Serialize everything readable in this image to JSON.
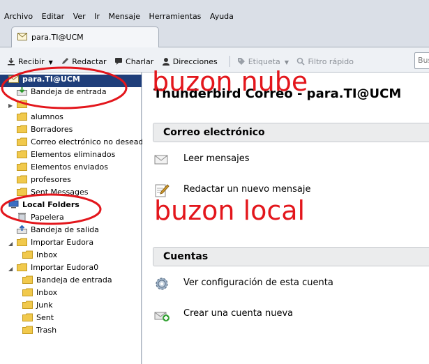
{
  "menubar": {
    "items": [
      "Archivo",
      "Editar",
      "Ver",
      "Ir",
      "Mensaje",
      "Herramientas",
      "Ayuda"
    ]
  },
  "tab": {
    "label": "para.TI@UCM"
  },
  "toolbar": {
    "get_mail": "Recibir",
    "write": "Redactar",
    "chat": "Charlar",
    "address_book": "Direcciones",
    "tag": "Etiqueta",
    "quick_filter": "Filtro rápido",
    "search_placeholder": "Bus"
  },
  "folders": [
    {
      "label": "para.TI@UCM",
      "type": "account"
    },
    {
      "label": "Bandeja de entrada",
      "type": "inbox"
    },
    {
      "label": "",
      "type": "folder"
    },
    {
      "label": "alumnos",
      "type": "folder"
    },
    {
      "label": "Borradores",
      "type": "folder"
    },
    {
      "label": "Correo electrónico no deseado",
      "type": "folder"
    },
    {
      "label": "Elementos eliminados",
      "type": "folder"
    },
    {
      "label": "Elementos enviados",
      "type": "folder"
    },
    {
      "label": "profesores",
      "type": "folder"
    },
    {
      "label": "Sent Messages",
      "type": "folder"
    },
    {
      "label": "Local Folders",
      "type": "local"
    },
    {
      "label": "Papelera",
      "type": "trash"
    },
    {
      "label": "Bandeja de salida",
      "type": "outbox"
    },
    {
      "label": "Importar Eudora",
      "type": "folder"
    },
    {
      "label": "Inbox",
      "type": "folder"
    },
    {
      "label": "Importar Eudora0",
      "type": "folder"
    },
    {
      "label": "Bandeja de entrada",
      "type": "folder"
    },
    {
      "label": "Inbox",
      "type": "folder"
    },
    {
      "label": "Junk",
      "type": "folder"
    },
    {
      "label": "Sent",
      "type": "folder"
    },
    {
      "label": "Trash",
      "type": "folder"
    }
  ],
  "main": {
    "title": "Thunderbird Correo - para.TI@UCM",
    "email_section": "Correo electrónico",
    "read_messages": "Leer mensajes",
    "write_message": "Redactar un nuevo mensaje",
    "accounts_section": "Cuentas",
    "view_settings": "Ver configuración de esta cuenta",
    "create_account": "Crear una cuenta nueva"
  },
  "annotations": {
    "cloud": "buzon nube",
    "local": "buzon local",
    "color": "#e3161c"
  },
  "colors": {
    "selected": "#1f3e7a",
    "folder": "#f1c94c"
  }
}
